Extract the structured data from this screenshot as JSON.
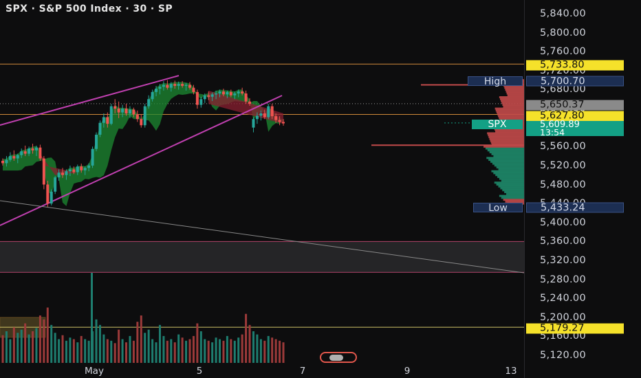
{
  "header": {
    "title": "SPX · S&P 500 Index · 30 · SP"
  },
  "price_axis": {
    "ticks": [
      "5,840.00",
      "5,800.00",
      "5,760.00",
      "5,720.00",
      "5,680.00",
      "5,640.00",
      "5,600.00",
      "5,560.00",
      "5,520.00",
      "5,480.00",
      "5,440.00",
      "5,400.00",
      "5,360.00",
      "5,320.00",
      "5,280.00",
      "5,240.00",
      "5,200.00",
      "5,160.00",
      "5,120.00"
    ],
    "tick_values": [
      5840,
      5800,
      5760,
      5720,
      5680,
      5640,
      5600,
      5560,
      5520,
      5480,
      5440,
      5400,
      5360,
      5320,
      5280,
      5240,
      5200,
      5160,
      5120
    ],
    "tags": {
      "resistance": "5,733.80",
      "high": "5,700.70",
      "prev_close": "5,650.37",
      "level": "5,627.80",
      "last": "5,609.89",
      "countdown": "13:54",
      "low": "5,433.24",
      "support": "5,179.27"
    },
    "labels": {
      "high": "High",
      "symbol": "SPX",
      "low": "Low"
    }
  },
  "time_axis": {
    "labels": [
      "May",
      "5",
      "7",
      "9",
      "13"
    ]
  },
  "colors": {
    "background": "#0d0d0e",
    "up": "#26a69a",
    "down": "#ef5350",
    "channel": "#c040b0",
    "yellow": "#f5e12a",
    "teal": "#13a085"
  },
  "chart_data": {
    "type": "candlestick",
    "symbol": "SPX",
    "interval": "30",
    "levels": {
      "resistance": 5733.8,
      "high": 5700.7,
      "prev_close": 5650.37,
      "level": 5627.8,
      "last": 5609.89,
      "low": 5433.24,
      "support": 5179.27
    },
    "candles": [
      [
        5530,
        5535,
        5520,
        5525
      ],
      [
        5525,
        5540,
        5518,
        5532
      ],
      [
        5532,
        5548,
        5528,
        5540
      ],
      [
        5540,
        5552,
        5530,
        5535
      ],
      [
        5535,
        5545,
        5525,
        5542
      ],
      [
        5542,
        5556,
        5536,
        5550
      ],
      [
        5550,
        5562,
        5540,
        5545
      ],
      [
        5545,
        5560,
        5540,
        5556
      ],
      [
        5556,
        5566,
        5545,
        5552
      ],
      [
        5552,
        5562,
        5540,
        5558
      ],
      [
        5558,
        5564,
        5530,
        5535
      ],
      [
        5535,
        5540,
        5470,
        5480
      ],
      [
        5480,
        5488,
        5433,
        5440
      ],
      [
        5440,
        5470,
        5436,
        5465
      ],
      [
        5465,
        5498,
        5460,
        5495
      ],
      [
        5495,
        5512,
        5488,
        5505
      ],
      [
        5505,
        5515,
        5494,
        5500
      ],
      [
        5500,
        5512,
        5490,
        5508
      ],
      [
        5508,
        5520,
        5498,
        5512
      ],
      [
        5512,
        5518,
        5502,
        5506
      ],
      [
        5506,
        5522,
        5500,
        5518
      ],
      [
        5518,
        5524,
        5505,
        5510
      ],
      [
        5510,
        5518,
        5500,
        5515
      ],
      [
        5515,
        5525,
        5508,
        5520
      ],
      [
        5520,
        5560,
        5515,
        5555
      ],
      [
        5555,
        5590,
        5550,
        5585
      ],
      [
        5585,
        5615,
        5580,
        5610
      ],
      [
        5610,
        5630,
        5600,
        5622
      ],
      [
        5622,
        5632,
        5600,
        5608
      ],
      [
        5608,
        5650,
        5605,
        5645
      ],
      [
        5645,
        5660,
        5630,
        5640
      ],
      [
        5640,
        5655,
        5620,
        5632
      ],
      [
        5632,
        5648,
        5622,
        5640
      ],
      [
        5640,
        5650,
        5625,
        5630
      ],
      [
        5630,
        5645,
        5620,
        5638
      ],
      [
        5638,
        5642,
        5622,
        5628
      ],
      [
        5628,
        5636,
        5612,
        5618
      ],
      [
        5618,
        5628,
        5600,
        5605
      ],
      [
        5605,
        5650,
        5600,
        5645
      ],
      [
        5645,
        5668,
        5640,
        5660
      ],
      [
        5660,
        5680,
        5655,
        5675
      ],
      [
        5675,
        5688,
        5666,
        5682
      ],
      [
        5682,
        5692,
        5670,
        5686
      ],
      [
        5686,
        5698,
        5678,
        5690
      ],
      [
        5690,
        5700,
        5680,
        5684
      ],
      [
        5684,
        5696,
        5676,
        5692
      ],
      [
        5692,
        5699,
        5682,
        5688
      ],
      [
        5688,
        5697,
        5680,
        5692
      ],
      [
        5692,
        5698,
        5684,
        5688
      ],
      [
        5688,
        5694,
        5678,
        5690
      ],
      [
        5690,
        5696,
        5680,
        5684
      ],
      [
        5684,
        5690,
        5670,
        5675
      ],
      [
        5675,
        5680,
        5640,
        5648
      ],
      [
        5648,
        5665,
        5642,
        5660
      ],
      [
        5660,
        5672,
        5652,
        5668
      ],
      [
        5668,
        5676,
        5658,
        5665
      ],
      [
        5665,
        5674,
        5656,
        5670
      ],
      [
        5670,
        5678,
        5660,
        5672
      ],
      [
        5672,
        5680,
        5664,
        5676
      ],
      [
        5676,
        5682,
        5666,
        5670
      ],
      [
        5670,
        5678,
        5662,
        5675
      ],
      [
        5675,
        5680,
        5664,
        5668
      ],
      [
        5668,
        5676,
        5660,
        5672
      ],
      [
        5672,
        5680,
        5664,
        5676
      ],
      [
        5676,
        5684,
        5668,
        5672
      ],
      [
        5672,
        5678,
        5650,
        5655
      ],
      [
        5655,
        5662,
        5646,
        5650
      ],
      [
        5600,
        5622,
        5590,
        5618
      ],
      [
        5618,
        5632,
        5608,
        5625
      ],
      [
        5625,
        5636,
        5615,
        5630
      ],
      [
        5630,
        5638,
        5618,
        5622
      ],
      [
        5622,
        5650,
        5618,
        5645
      ],
      [
        5645,
        5650,
        5618,
        5624
      ],
      [
        5624,
        5630,
        5610,
        5616
      ],
      [
        5616,
        5624,
        5605,
        5612
      ],
      [
        5612,
        5618,
        5604,
        5609
      ]
    ],
    "volumes": [
      35,
      40,
      30,
      45,
      38,
      42,
      50,
      36,
      40,
      44,
      60,
      55,
      70,
      48,
      38,
      30,
      35,
      28,
      32,
      30,
      26,
      34,
      30,
      28,
      40,
      55,
      48,
      36,
      30,
      28,
      25,
      42,
      30,
      26,
      34,
      28,
      52,
      60,
      38,
      42,
      30,
      26,
      48,
      34,
      28,
      30,
      26,
      36,
      32,
      28,
      30,
      34,
      50,
      40,
      30,
      28,
      26,
      32,
      30,
      28,
      34,
      30,
      28,
      32,
      36,
      62,
      48,
      40,
      36,
      30,
      28,
      34,
      32,
      30,
      28,
      26
    ]
  }
}
